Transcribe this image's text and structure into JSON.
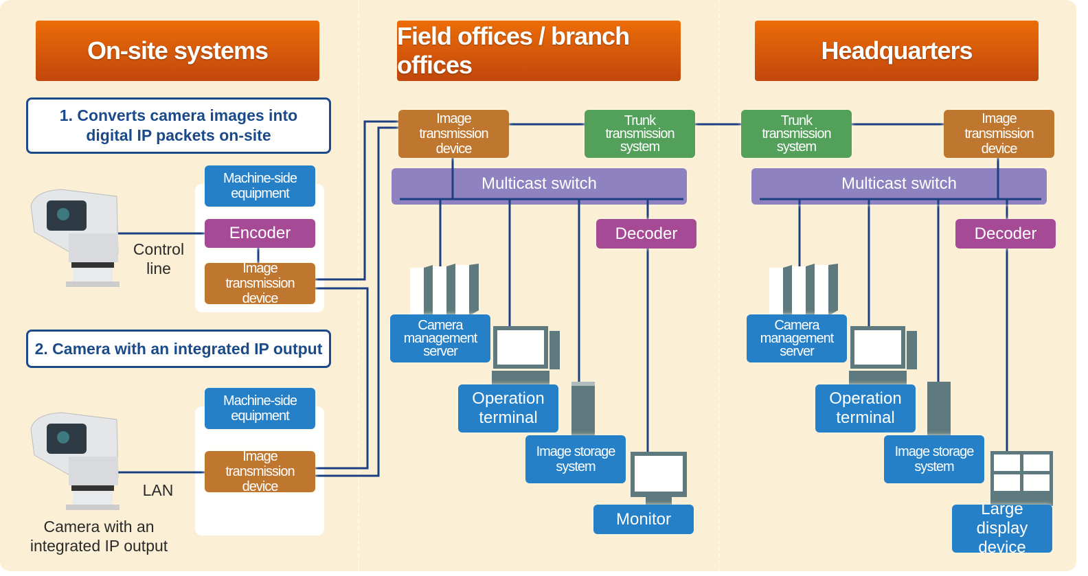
{
  "columns": {
    "onsite": "On-site systems",
    "field": "Field offices / branch offices",
    "hq": "Headquarters"
  },
  "onsite": {
    "note1": "1. Converts camera images into digital IP packets on-site",
    "note2": "2. Camera with an integrated IP output",
    "machine_side": "Machine-side equipment",
    "encoder": "Encoder",
    "image_tx": "Image transmission device",
    "control_line": "Control line",
    "lan": "LAN",
    "camera_caption": "Camera with an integrated IP output"
  },
  "field": {
    "image_tx": "Image transmission device",
    "trunk": "Trunk transmission system",
    "switch": "Multicast switch",
    "decoder": "Decoder",
    "server": "Camera management server",
    "terminal": "Operation terminal",
    "storage": "Image storage system",
    "monitor": "Monitor"
  },
  "hq": {
    "trunk": "Trunk transmission system",
    "image_tx": "Image transmission device",
    "switch": "Multicast switch",
    "decoder": "Decoder",
    "server": "Camera management server",
    "terminal": "Operation terminal",
    "storage": "Image storage system",
    "display": "Large display device"
  },
  "colors": {
    "header": "#e0600a",
    "image_tx": "#bf7730",
    "trunk": "#52a05a",
    "switch": "#8f82c0",
    "codec": "#a64a96",
    "equipment": "#2580c8",
    "line": "#1b3f80"
  }
}
